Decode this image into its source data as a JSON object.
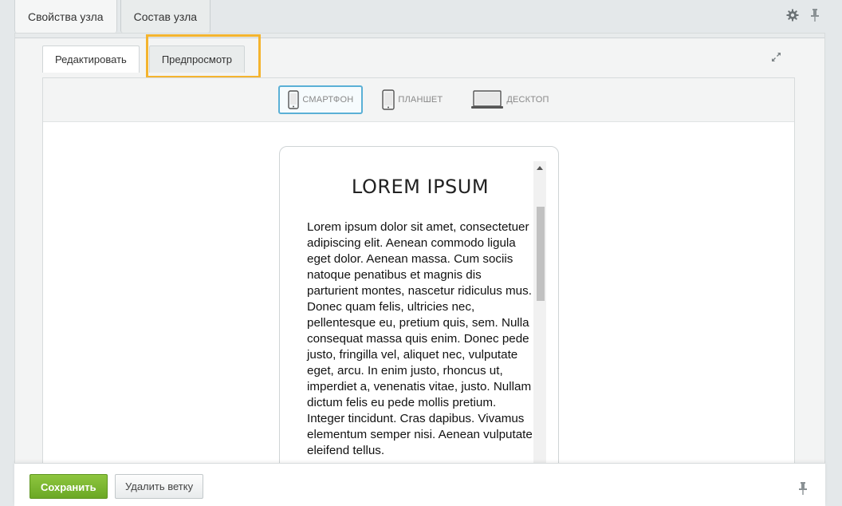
{
  "top_tabs": [
    {
      "label": "Свойства узла"
    },
    {
      "label": "Состав узла"
    }
  ],
  "inner_tabs": [
    {
      "label": "Редактировать"
    },
    {
      "label": "Предпросмотр"
    }
  ],
  "devices": [
    {
      "label": "СМАРТФОН",
      "icon": "smartphone-icon",
      "active": true
    },
    {
      "label": "ПЛАНШЕТ",
      "icon": "tablet-icon",
      "active": false
    },
    {
      "label": "ДЕСКТОП",
      "icon": "desktop-icon",
      "active": false
    }
  ],
  "preview": {
    "title": "LOREM IPSUM",
    "body": "Lorem ipsum dolor sit amet, consectetuer adipiscing elit. Aenean commodo ligula eget dolor. Aenean massa. Cum sociis natoque penatibus et magnis dis parturient montes, nascetur ridiculus mus. Donec quam felis, ultricies nec, pellentesque eu, pretium quis, sem. Nulla consequat massa quis enim. Donec pede justo, fringilla vel, aliquet nec, vulputate eget, arcu. In enim justo, rhoncus ut, imperdiet a, venenatis vitae, justo. Nullam dictum felis eu pede mollis pretium. Integer tincidunt. Cras dapibus. Vivamus elementum semper nisi. Aenean vulputate eleifend tellus."
  },
  "footer": {
    "save_label": "Сохранить",
    "delete_label": "Удалить ветку"
  },
  "colors": {
    "save_green": "#7ab832",
    "highlight_orange": "#f4b42f",
    "active_device_blue": "#5ab0d6"
  }
}
